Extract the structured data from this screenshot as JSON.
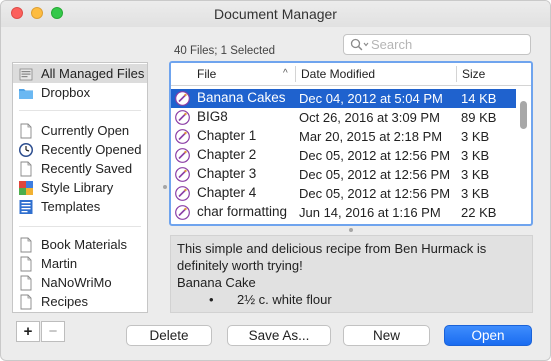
{
  "window": {
    "title": "Document Manager"
  },
  "file_count": "40 Files; 1 Selected",
  "search": {
    "placeholder": "Search",
    "icon": "search-icon"
  },
  "sidebar": {
    "items": [
      {
        "label": "All Managed Files",
        "icon": "managed-files-icon",
        "selected": true
      },
      {
        "label": "Dropbox",
        "icon": "folder-icon"
      },
      {
        "label": "Currently Open",
        "icon": "document-icon"
      },
      {
        "label": "Recently Opened",
        "icon": "clock-icon"
      },
      {
        "label": "Recently Saved",
        "icon": "document-icon"
      },
      {
        "label": "Style Library",
        "icon": "style-library-icon"
      },
      {
        "label": "Templates",
        "icon": "templates-icon"
      },
      {
        "label": "Book Materials",
        "icon": "document-icon"
      },
      {
        "label": "Martin",
        "icon": "document-icon"
      },
      {
        "label": "NaNoWriMo",
        "icon": "document-icon"
      },
      {
        "label": "Recipes",
        "icon": "document-icon"
      }
    ]
  },
  "table": {
    "columns": [
      "File",
      "Date Modified",
      "Size"
    ],
    "sort_indicator": "^",
    "rows": [
      {
        "name": "Banana Cakes",
        "date": "Dec 04, 2012 at 5:04 PM",
        "size": "14 KB",
        "selected": true
      },
      {
        "name": "BIG8",
        "date": "Oct 26, 2016 at 3:09 PM",
        "size": "89 KB"
      },
      {
        "name": "Chapter 1",
        "date": "Mar 20, 2015 at 2:18 PM",
        "size": "3 KB"
      },
      {
        "name": "Chapter 2",
        "date": "Dec 05, 2012 at 12:56 PM",
        "size": "3 KB"
      },
      {
        "name": "Chapter 3",
        "date": "Dec 05, 2012 at 12:56 PM",
        "size": "3 KB"
      },
      {
        "name": "Chapter 4",
        "date": "Dec 05, 2012 at 12:56 PM",
        "size": "3 KB"
      },
      {
        "name": "char formatting",
        "date": "Jun 14, 2016 at 1:16 PM",
        "size": "22 KB"
      }
    ]
  },
  "preview": {
    "lines": [
      "This simple and delicious recipe from Ben Hurmack is",
      "definitely worth trying!",
      "Banana Cake"
    ],
    "bullet": "•",
    "bullet_text": "2½ c. white flour"
  },
  "buttons": {
    "add": "+",
    "remove": "−",
    "delete": "Delete",
    "save_as": "Save As...",
    "new": "New",
    "open": "Open"
  },
  "colors": {
    "selection_blue": "#1f62ce",
    "focus_ring": "#6fa4ee",
    "primary_button": "#1a6cf0"
  }
}
